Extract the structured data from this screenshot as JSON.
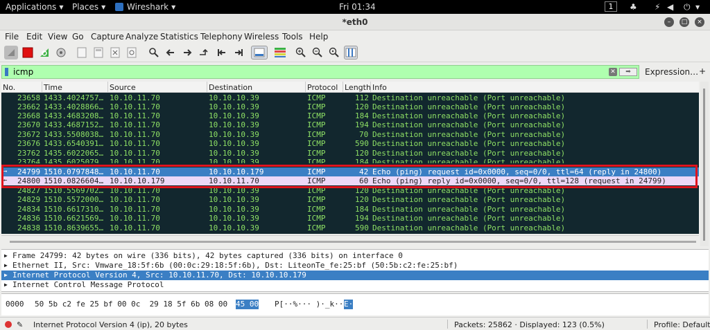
{
  "topbar": {
    "applications": "Applications",
    "places": "Places",
    "app_name": "Wireshark",
    "clock": "Fri 01:34",
    "workspace": "1"
  },
  "window": {
    "title": "*eth0"
  },
  "menu": [
    "File",
    "Edit",
    "View",
    "Go",
    "Capture",
    "Analyze",
    "Statistics",
    "Telephony",
    "Wireless",
    "Tools",
    "Help"
  ],
  "toolbar": {
    "icons": [
      "shark-fin-start-icon",
      "stop-capture-icon",
      "restart-capture-icon",
      "capture-options-icon",
      "open-file-icon",
      "save-file-icon",
      "close-file-icon",
      "reload-file-icon",
      "find-packet-icon",
      "go-back-icon",
      "go-forward-icon",
      "go-to-packet-icon",
      "go-first-icon",
      "go-last-icon",
      "autoscroll-icon",
      "colorize-icon",
      "zoom-in-icon",
      "zoom-out-icon",
      "zoom-normal-icon",
      "resize-columns-icon"
    ]
  },
  "filter": {
    "value": "icmp",
    "expression_label": "Expression…",
    "plus_label": "+"
  },
  "packet_list": {
    "columns": [
      "No.",
      "Time",
      "Source",
      "Destination",
      "Protocol",
      "Length",
      "Info"
    ],
    "rows": [
      {
        "no": "23658",
        "time": "1433.4024757…",
        "src": "10.10.11.70",
        "dst": "10.10.10.39",
        "proto": "ICMP",
        "len": "112",
        "info": "Destination unreachable (Port unreachable)"
      },
      {
        "no": "23662",
        "time": "1433.4028866…",
        "src": "10.10.11.70",
        "dst": "10.10.10.39",
        "proto": "ICMP",
        "len": "120",
        "info": "Destination unreachable (Port unreachable)"
      },
      {
        "no": "23668",
        "time": "1433.4683208…",
        "src": "10.10.11.70",
        "dst": "10.10.10.39",
        "proto": "ICMP",
        "len": "184",
        "info": "Destination unreachable (Port unreachable)"
      },
      {
        "no": "23670",
        "time": "1433.4687152…",
        "src": "10.10.11.70",
        "dst": "10.10.10.39",
        "proto": "ICMP",
        "len": "194",
        "info": "Destination unreachable (Port unreachable)"
      },
      {
        "no": "23672",
        "time": "1433.5508038…",
        "src": "10.10.11.70",
        "dst": "10.10.10.39",
        "proto": "ICMP",
        "len": "70",
        "info": "Destination unreachable (Port unreachable)"
      },
      {
        "no": "23676",
        "time": "1433.6540391…",
        "src": "10.10.11.70",
        "dst": "10.10.10.39",
        "proto": "ICMP",
        "len": "590",
        "info": "Destination unreachable (Port unreachable)"
      },
      {
        "no": "23762",
        "time": "1435.6022065…",
        "src": "10.10.11.70",
        "dst": "10.10.10.39",
        "proto": "ICMP",
        "len": "120",
        "info": "Destination unreachable (Port unreachable)"
      },
      {
        "no": "23764",
        "time": "1435.6025079…",
        "src": "10.10.11.70",
        "dst": "10.10.10.39",
        "proto": "ICMP",
        "len": "184",
        "info": "Destination unreachable (Port unreachable)"
      },
      {
        "no": "24799",
        "time": "1510.0797848…",
        "src": "10.10.11.70",
        "dst": "10.10.10.179",
        "proto": "ICMP",
        "len": "42",
        "info": "Echo (ping) request  id=0x0000, seq=0/0, ttl=64 (reply in 24800)"
      },
      {
        "no": "24800",
        "time": "1510.0826604…",
        "src": "10.10.10.179",
        "dst": "10.10.11.70",
        "proto": "ICMP",
        "len": "60",
        "info": "Echo (ping) reply    id=0x0000, seq=0/0, ttl=128 (request in 24799)"
      },
      {
        "no": "24827",
        "time": "1510.5569702…",
        "src": "10.10.11.70",
        "dst": "10.10.10.39",
        "proto": "ICMP",
        "len": "120",
        "info": "Destination unreachable (Port unreachable)"
      },
      {
        "no": "24829",
        "time": "1510.5572000…",
        "src": "10.10.11.70",
        "dst": "10.10.10.39",
        "proto": "ICMP",
        "len": "120",
        "info": "Destination unreachable (Port unreachable)"
      },
      {
        "no": "24834",
        "time": "1510.6617310…",
        "src": "10.10.11.70",
        "dst": "10.10.10.39",
        "proto": "ICMP",
        "len": "184",
        "info": "Destination unreachable (Port unreachable)"
      },
      {
        "no": "24836",
        "time": "1510.6621569…",
        "src": "10.10.11.70",
        "dst": "10.10.10.39",
        "proto": "ICMP",
        "len": "194",
        "info": "Destination unreachable (Port unreachable)"
      },
      {
        "no": "24838",
        "time": "1510.8639655…",
        "src": "10.10.11.70",
        "dst": "10.10.10.39",
        "proto": "ICMP",
        "len": "590",
        "info": "Destination unreachable (Port unreachable)"
      }
    ]
  },
  "details": [
    "Frame 24799: 42 bytes on wire (336 bits), 42 bytes captured (336 bits) on interface 0",
    "Ethernet II, Src: Vmware_18:5f:6b (00:0c:29:18:5f:6b), Dst: LiteonTe_fe:25:bf (50:5b:c2:fe:25:bf)",
    "Internet Protocol Version 4, Src: 10.10.11.70, Dst: 10.10.10.179",
    "Internet Control Message Protocol"
  ],
  "bytes": {
    "offset": "0000",
    "hex_plain": "50 5b c2 fe 25 bf 00 0c  29 18 5f 6b 08 00",
    "hex_highlight": "45 00",
    "ascii_plain": "P[··%··· )·_k··",
    "ascii_highlight": "E·"
  },
  "status": {
    "field": "Internet Protocol Version 4 (ip), 20 bytes",
    "packets": "Packets: 25862 · Displayed: 123 (0.5%)",
    "profile": "Profile: Default"
  },
  "colors": {
    "list_bg": "#12272e",
    "list_fg": "#8ee065",
    "selected": "#3b7fc4",
    "related": "#ecd8f7",
    "filter_ok": "#afffaf",
    "annotation": "#e0141e"
  }
}
